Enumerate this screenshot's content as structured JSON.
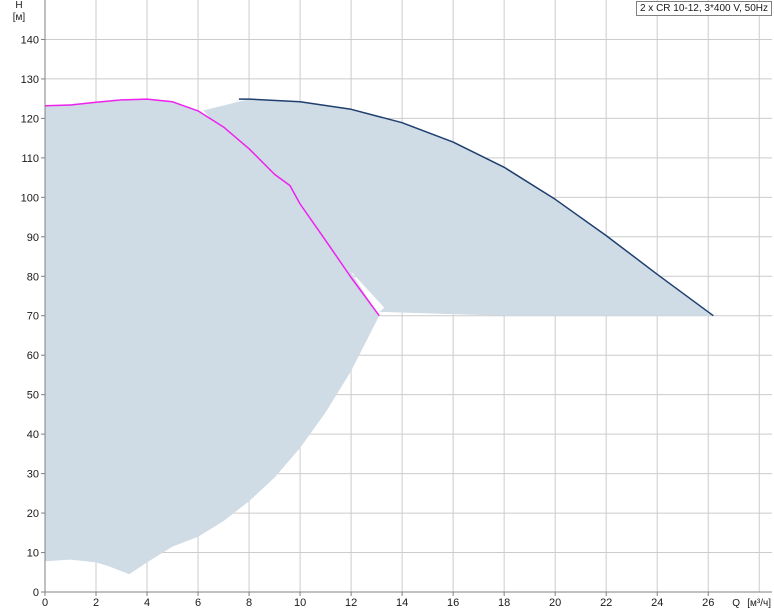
{
  "chart_data": {
    "type": "line",
    "title": "2 x CR 10-12, 3*400 V, 50Hz",
    "ylabel": "H",
    "yunit": "[м]",
    "xlabel": "Q",
    "xunit": "[м³/ч]",
    "xlim": [
      0,
      28.5
    ],
    "ylim": [
      0,
      150
    ],
    "xticks": [
      0,
      2,
      4,
      6,
      8,
      10,
      12,
      14,
      16,
      18,
      20,
      22,
      24,
      26
    ],
    "yticks": [
      0,
      10,
      20,
      30,
      40,
      50,
      60,
      70,
      80,
      90,
      100,
      110,
      120,
      130,
      140
    ],
    "grid": true,
    "colors": {
      "single_pump_curve": "#ee22ee",
      "dual_pump_curve": "#1f3f6f",
      "operating_area": "#cfdbe5",
      "grid": "#cccccc",
      "axis": "#808080"
    },
    "series": [
      {
        "role": "single_pump_curve",
        "x": [
          0,
          1,
          2,
          3,
          4,
          5,
          6,
          7,
          8,
          9,
          9.6,
          10,
          11,
          12,
          13.1
        ],
        "y": [
          123.2,
          123.4,
          124.1,
          124.7,
          124.9,
          124.2,
          121.9,
          117.8,
          112.3,
          105.8,
          103.0,
          98.3,
          89.1,
          79.7,
          70.0
        ]
      },
      {
        "role": "dual_pump_curve",
        "x": [
          7.6,
          8,
          10,
          12,
          14,
          16,
          18,
          20,
          22,
          24,
          26.2
        ],
        "y": [
          124.9,
          124.9,
          124.2,
          122.3,
          118.9,
          114.0,
          107.6,
          99.5,
          90.3,
          80.5,
          70.0
        ]
      }
    ],
    "areas": [
      {
        "role": "single_pump_operating_area",
        "x": [
          0,
          2,
          4,
          5,
          6,
          7,
          8,
          9,
          9.6,
          10.5,
          11.5,
          12.3,
          13.1,
          12,
          11,
          10,
          9,
          8,
          7,
          6,
          5,
          4,
          3.3,
          2.5,
          2,
          1,
          0
        ],
        "y": [
          123.2,
          124.1,
          124.9,
          124.2,
          121.9,
          117.8,
          112.3,
          105.8,
          103.0,
          96.0,
          86.0,
          78.0,
          70.0,
          56.0,
          45.5,
          36.5,
          29.0,
          23.0,
          18.0,
          14.0,
          11.5,
          7.5,
          4.5,
          6.5,
          7.5,
          8.2,
          7.8
        ]
      },
      {
        "role": "dual_pump_operating_area",
        "x": [
          6.2,
          8,
          10,
          12,
          14,
          16,
          18,
          20,
          22,
          24,
          26.2,
          18,
          13.1,
          13.3
        ],
        "y": [
          122.0,
          124.9,
          124.2,
          122.3,
          118.9,
          114.0,
          107.6,
          99.5,
          90.3,
          80.5,
          70.0,
          70.0,
          71.0,
          72.0
        ]
      }
    ]
  }
}
